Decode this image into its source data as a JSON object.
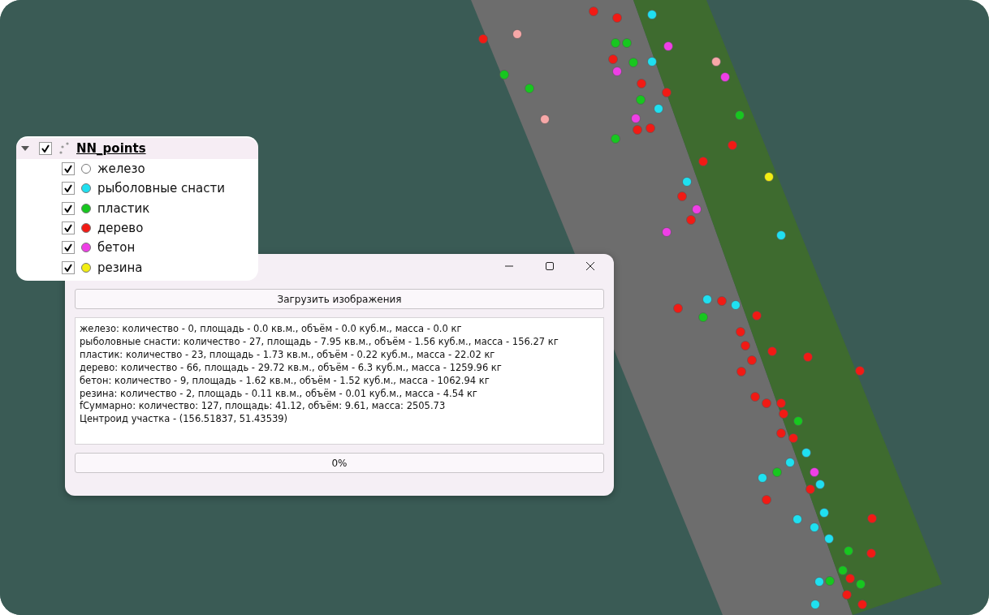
{
  "legend": {
    "layer": {
      "name": "NN_points",
      "expanded": true,
      "checked": true
    },
    "items": [
      {
        "label": "железо",
        "checked": true,
        "color": "#ffffff"
      },
      {
        "label": "рыболовные снасти",
        "checked": true,
        "color": "#1fe0f0"
      },
      {
        "label": "пластик",
        "checked": true,
        "color": "#17c71f"
      },
      {
        "label": "дерево",
        "checked": true,
        "color": "#f21a14"
      },
      {
        "label": "бетон",
        "checked": true,
        "color": "#ef3fe6"
      },
      {
        "label": "резина",
        "checked": true,
        "color": "#f2ee12"
      }
    ]
  },
  "dialog": {
    "load_button": "Загрузить изображения",
    "output_lines": [
      "железо: количество - 0,  площадь - 0.0 кв.м., объём - 0.0 куб.м., масса - 0.0 кг",
      "рыболовные снасти: количество - 27,  площадь - 7.95 кв.м., объём - 1.56 куб.м., масса - 156.27 кг",
      "пластик: количество - 23,  площадь - 1.73 кв.м., объём - 0.22 куб.м., масса - 22.02 кг",
      "дерево: количество - 66,  площадь - 29.72 кв.м., объём - 6.3 куб.м., масса - 1259.96 кг",
      "бетон: количество - 9,  площадь - 1.62 кв.м., объём - 1.52 куб.м., масса - 1062.94 кг",
      "резина: количество - 2,  площадь - 0.11 кв.м., объём - 0.01 куб.м., масса - 4.54 кг",
      "fСуммарно: количество: 127, площадь: 41.12, объём: 9.61, масса: 2505.73",
      "Центроид участка - (156.51837, 51.43539)"
    ],
    "progress": {
      "level": 0,
      "reading": "0%"
    }
  }
}
